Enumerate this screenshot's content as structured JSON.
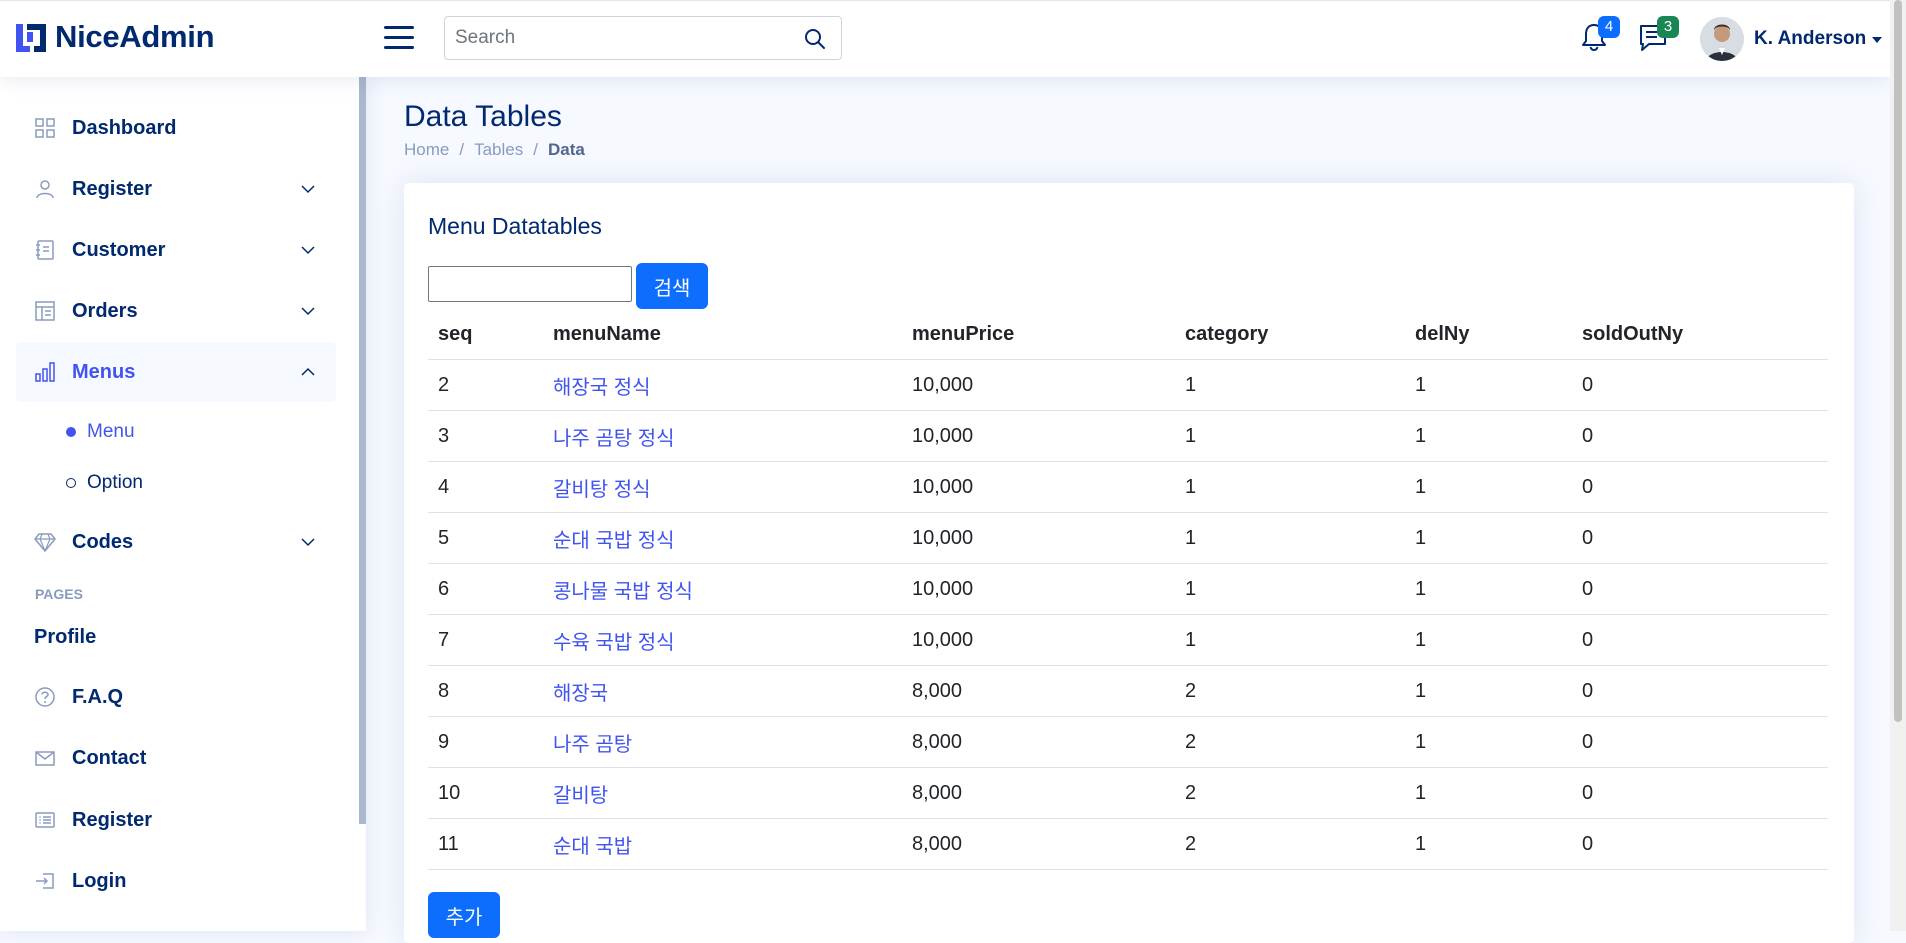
{
  "header": {
    "logo_text": "NiceAdmin",
    "search_placeholder": "Search",
    "notifications_count": "4",
    "messages_count": "3",
    "user_name": "K. Anderson",
    "colors": {
      "primary": "#012970",
      "notif_badge": "#0d6efd",
      "msg_badge": "#198754"
    }
  },
  "sidebar": {
    "items": [
      {
        "label": "Dashboard",
        "icon": "grid-icon"
      },
      {
        "label": "Register",
        "icon": "person-icon"
      },
      {
        "label": "Customer",
        "icon": "journal-icon"
      },
      {
        "label": "Orders",
        "icon": "layout-icon"
      },
      {
        "label": "Menus",
        "icon": "bar-chart-icon"
      },
      {
        "label": "Codes",
        "icon": "gem-icon"
      }
    ],
    "menus_sub": [
      {
        "label": "Menu"
      },
      {
        "label": "Option"
      }
    ],
    "pages_heading": "PAGES",
    "pages": [
      {
        "label": "Profile"
      },
      {
        "label": "F.A.Q",
        "icon": "question-circle-icon"
      },
      {
        "label": "Contact",
        "icon": "envelope-icon"
      },
      {
        "label": "Register",
        "icon": "card-list-icon"
      },
      {
        "label": "Login",
        "icon": "box-arrow-in-right-icon"
      }
    ]
  },
  "main": {
    "title": "Data Tables",
    "breadcrumb": [
      "Home",
      "Tables",
      "Data"
    ],
    "card_title": "Menu Datatables",
    "search_button": "검색",
    "add_button": "추가",
    "columns": [
      "seq",
      "menuName",
      "menuPrice",
      "category",
      "delNy",
      "soldOutNy"
    ],
    "rows": [
      [
        "2",
        "해장국 정식",
        "10,000",
        "1",
        "1",
        "0"
      ],
      [
        "3",
        "나주 곰탕 정식",
        "10,000",
        "1",
        "1",
        "0"
      ],
      [
        "4",
        "갈비탕 정식",
        "10,000",
        "1",
        "1",
        "0"
      ],
      [
        "5",
        "순대 국밥 정식",
        "10,000",
        "1",
        "1",
        "0"
      ],
      [
        "6",
        "콩나물 국밥 정식",
        "10,000",
        "1",
        "1",
        "0"
      ],
      [
        "7",
        "수육 국밥 정식",
        "10,000",
        "1",
        "1",
        "0"
      ],
      [
        "8",
        "해장국",
        "8,000",
        "2",
        "1",
        "0"
      ],
      [
        "9",
        "나주 곰탕",
        "8,000",
        "2",
        "1",
        "0"
      ],
      [
        "10",
        "갈비탕",
        "8,000",
        "2",
        "1",
        "0"
      ],
      [
        "11",
        "순대 국밥",
        "8,000",
        "2",
        "1",
        "0"
      ]
    ]
  }
}
